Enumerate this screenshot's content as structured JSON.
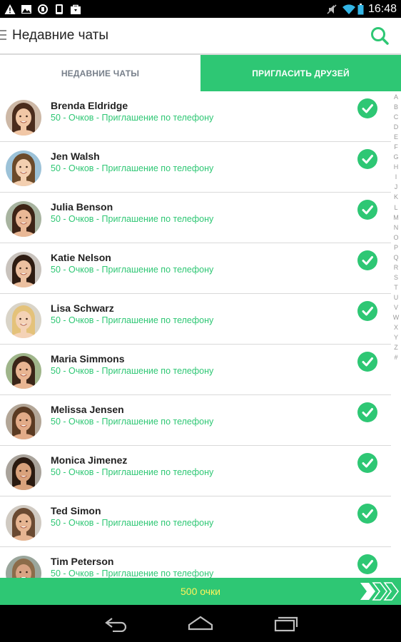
{
  "status_bar": {
    "time": "16:48",
    "left_icons": [
      "warning-icon",
      "image-icon",
      "sync-icon",
      "phone-icon",
      "shopping-bag-icon"
    ],
    "right_icons": [
      "mute-icon",
      "wifi-icon",
      "battery-icon"
    ]
  },
  "header": {
    "title": "Недавние чаты",
    "menu_icon": "hamburger-icon",
    "search_icon": "search-icon"
  },
  "tabs": [
    {
      "label": "НЕДАВНИЕ ЧАТЫ",
      "active": false
    },
    {
      "label": "ПРИГЛАСИТЬ ДРУЗЕЙ",
      "active": true
    }
  ],
  "alphabet": [
    "A",
    "B",
    "C",
    "D",
    "E",
    "F",
    "G",
    "H",
    "I",
    "J",
    "K",
    "L",
    "M",
    "N",
    "O",
    "P",
    "Q",
    "R",
    "S",
    "T",
    "U",
    "V",
    "W",
    "X",
    "Y",
    "Z",
    "#"
  ],
  "contacts": [
    {
      "name": "Brenda Eldridge",
      "subtitle": "50 - Очков - Приглашение по телефону",
      "checked": true
    },
    {
      "name": "Jen Walsh",
      "subtitle": "50 - Очков - Приглашение по телефону",
      "checked": true
    },
    {
      "name": "Julia Benson",
      "subtitle": "50 - Очков - Приглашение по телефону",
      "checked": true
    },
    {
      "name": "Katie Nelson",
      "subtitle": "50 - Очков - Приглашение по телефону",
      "checked": true
    },
    {
      "name": "Lisa Schwarz",
      "subtitle": "50 - Очков - Приглашение по телефону",
      "checked": true
    },
    {
      "name": "Maria Simmons",
      "subtitle": "50 - Очков - Приглашение по телефону",
      "checked": true
    },
    {
      "name": "Melissa Jensen",
      "subtitle": "50 - Очков - Приглашение по телефону",
      "checked": true
    },
    {
      "name": "Monica Jimenez",
      "subtitle": "50 - Очков - Приглашение по телефону",
      "checked": true
    },
    {
      "name": "Ted Simon",
      "subtitle": "50 - Очков - Приглашение по телефону",
      "checked": true
    },
    {
      "name": "Tim Peterson",
      "subtitle": "50 - Очков - Приглашение по телефону",
      "checked": true
    }
  ],
  "footer": {
    "points_label": "500 очки",
    "next_icon": "triple-chevron-right-icon"
  },
  "nav_bar": {
    "icons": [
      "back-icon",
      "home-icon",
      "recent-apps-icon"
    ]
  },
  "colors": {
    "accent": "#2ec774",
    "points_text": "#fff35c",
    "tab_inactive_text": "#777f8a"
  }
}
